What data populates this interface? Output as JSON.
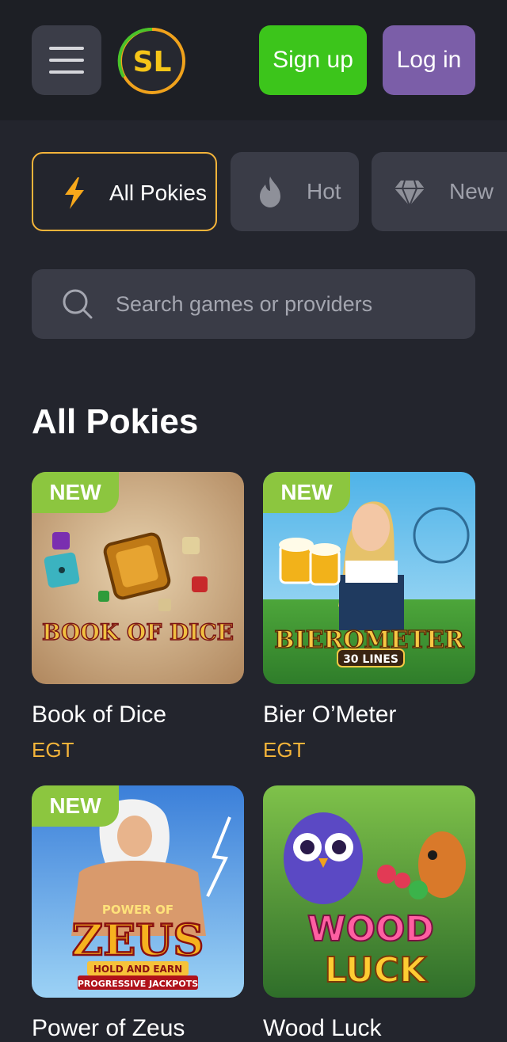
{
  "header": {
    "logo_text": "SL",
    "signup_label": "Sign up",
    "login_label": "Log in"
  },
  "filters": [
    {
      "label": "All Pokies",
      "icon": "lightning-icon",
      "active": true
    },
    {
      "label": "Hot",
      "icon": "fire-icon",
      "active": false
    },
    {
      "label": "New",
      "icon": "diamond-icon",
      "active": false
    }
  ],
  "search": {
    "placeholder": "Search games or providers",
    "value": ""
  },
  "section": {
    "title": "All Pokies"
  },
  "games": [
    {
      "name": "Book of Dice",
      "provider": "EGT",
      "badge": "NEW",
      "art_text": "BOOK OF DICE"
    },
    {
      "name": "Bier O’Meter",
      "provider": "EGT",
      "badge": "NEW",
      "art_text": "BIEROMETER",
      "art_sub": "30 LINES"
    },
    {
      "name": "Power of Zeus",
      "provider": "",
      "badge": "NEW",
      "art_text": "ZEUS",
      "art_top": "POWER OF",
      "art_sub": "HOLD AND EARN",
      "art_sub2": "PROGRESSIVE JACKPOTS"
    },
    {
      "name": "Wood Luck",
      "provider": "",
      "badge": "",
      "art_text": "WOOD",
      "art_text2": "LUCK"
    }
  ],
  "colors": {
    "background": "#23252d",
    "header": "#1d1f25",
    "signup": "#3cc51b",
    "login": "#7b5ea8",
    "accent": "#f4b43a",
    "badge": "#8cc63f"
  }
}
